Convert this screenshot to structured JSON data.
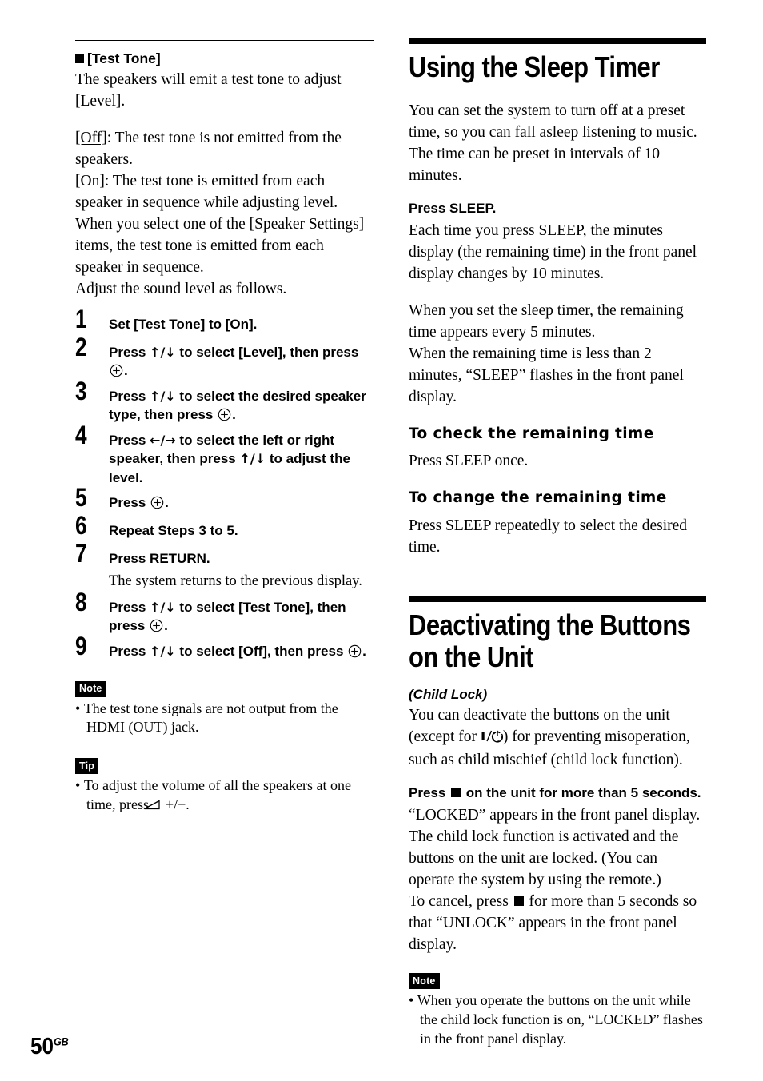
{
  "page": {
    "number": "50",
    "region_code": "GB"
  },
  "left_column": {
    "section_heading": "[Test Tone]",
    "intro_lines": [
      "The speakers will emit a test tone to adjust",
      "[Level]."
    ],
    "off_label": "[Off]",
    "off_text": ": The test tone is not emitted from the speakers.",
    "on_label": "[On]",
    "on_text": ": The test tone is emitted from each speaker in sequence while adjusting level. When you select one of the [Speaker Settings] items, the test tone is emitted from each speaker in sequence.",
    "adjust_line": "Adjust the sound level as follows.",
    "steps": [
      {
        "number": "1",
        "text": "Set [Test Tone] to [On]."
      },
      {
        "number": "2",
        "text_before": "Press ",
        "arrows": "↑/↓",
        "text_mid": " to select [Level], then press",
        "has_enter_icon": true,
        "text_after": "."
      },
      {
        "number": "3",
        "text_before": "Press ",
        "arrows": "↑/↓",
        "text_mid": " to select the desired speaker type, then press",
        "has_enter_icon": true,
        "text_after": "."
      },
      {
        "number": "4",
        "text_before": "Press ",
        "arrows": "←/→",
        "text_mid": " to select the left or right speaker, then press ",
        "arrows2": "↑/↓",
        "text_after": " to adjust the level."
      },
      {
        "number": "5",
        "text_before": "Press",
        "has_enter_icon": true,
        "text_after": "."
      },
      {
        "number": "6",
        "text": "Repeat Steps 3 to 5."
      },
      {
        "number": "7",
        "text": "Press RETURN.",
        "note": "The system returns to the previous display."
      },
      {
        "number": "8",
        "text_before": "Press ",
        "arrows": "↑/↓",
        "text_mid": " to select [Test Tone], then press",
        "has_enter_icon": true,
        "text_after": "."
      },
      {
        "number": "9",
        "text_before": "Press ",
        "arrows": "↑/↓",
        "text_mid": " to select [Off], then press",
        "has_enter_icon": true,
        "text_after": "."
      }
    ],
    "note_badge": "Note",
    "note_items": [
      "The test tone signals are not output from the HDMI (OUT) jack."
    ],
    "tip_badge": "Tip",
    "tip_text_before": "To adjust the volume of all the speakers at one time, press ",
    "tip_text_after": " +/−."
  },
  "right_column": {
    "heading_sleep": "Using the Sleep Timer",
    "sleep_intro": "You can set the system to turn off at a preset time, so you can fall asleep listening to music. The time can be preset in intervals of 10 minutes.",
    "press_sleep_heading": "Press SLEEP.",
    "sleep_para_1": "Each time you press SLEEP, the minutes display (the remaining time) in the front panel display changes by 10 minutes.",
    "sleep_para_2": "When you set the sleep timer, the remaining time appears every 5 minutes.",
    "sleep_para_3": "When the remaining time is less than 2 minutes, “SLEEP” flashes in the front panel display.",
    "check_heading": "To check the remaining time",
    "check_text": "Press SLEEP once.",
    "change_heading": "To change the remaining time",
    "change_text": "Press SLEEP repeatedly to select the desired time.",
    "heading_deactivating": "Deactivating the Buttons on the Unit",
    "child_lock_label": "(Child Lock)",
    "child_lock_before": "You can deactivate the buttons on the unit (except for ",
    "child_lock_after": ") for preventing misoperation, such as child mischief (child lock function).",
    "press_stop_before": "Press ",
    "press_stop_after": " on the unit for more than 5 seconds.",
    "locked_para": "“LOCKED” appears in the front panel display. The child lock function is activated and the buttons on the unit are locked. (You can operate the system by using the remote.)",
    "cancel_before": "To cancel, press ",
    "cancel_after": " for more than 5 seconds so that “UNLOCK” appears in the front panel display.",
    "note_badge": "Note",
    "note_items": [
      "When you operate the buttons on the unit while the child lock function is on, “LOCKED” flashes in the front panel display."
    ]
  },
  "icons": {
    "enter": "circled-plus-icon",
    "up_down": "up-down-arrows-icon",
    "left_right": "left-right-arrows-icon",
    "volume": "volume-wedge-icon",
    "power": "power-standby-icon",
    "stop": "stop-square-icon",
    "bullet_square": "black-square-bullet-icon"
  },
  "colors": {
    "text": "#000000",
    "background": "#ffffff",
    "badge_bg": "#000000",
    "badge_text": "#ffffff"
  }
}
